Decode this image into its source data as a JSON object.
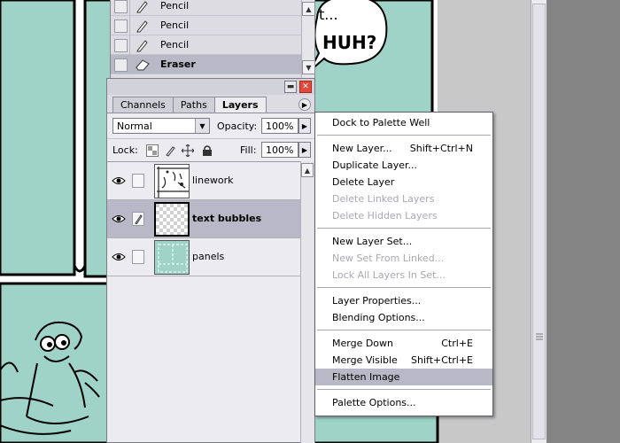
{
  "history": {
    "items": [
      {
        "label": "Pencil",
        "icon": "pencil-icon"
      },
      {
        "label": "Pencil",
        "icon": "pencil-icon"
      },
      {
        "label": "Pencil",
        "icon": "pencil-icon"
      },
      {
        "label": "Eraser",
        "icon": "eraser-icon",
        "selected": true
      }
    ]
  },
  "layers_palette": {
    "tabs": [
      {
        "label": "Channels"
      },
      {
        "label": "Paths"
      },
      {
        "label": "Layers",
        "active": true
      }
    ],
    "blend_mode": "Normal",
    "opacity_label": "Opacity:",
    "opacity_value": "100%",
    "lock_label": "Lock:",
    "fill_label": "Fill:",
    "fill_value": "100%",
    "layers": [
      {
        "name": "linework",
        "visible": true,
        "selected": false
      },
      {
        "name": "text bubbles",
        "visible": true,
        "selected": true
      },
      {
        "name": "panels",
        "visible": true,
        "selected": false
      }
    ]
  },
  "context_menu": {
    "items": [
      {
        "label": "Dock to Palette Well",
        "shortcut": "",
        "enabled": true
      },
      {
        "label": "New Layer...",
        "shortcut": "Shift+Ctrl+N",
        "enabled": true
      },
      {
        "label": "Duplicate Layer...",
        "shortcut": "",
        "enabled": true
      },
      {
        "label": "Delete Layer",
        "shortcut": "",
        "enabled": true
      },
      {
        "label": "Delete Linked Layers",
        "shortcut": "",
        "enabled": false
      },
      {
        "label": "Delete Hidden Layers",
        "shortcut": "",
        "enabled": false
      },
      {
        "label": "New Layer Set...",
        "shortcut": "",
        "enabled": true
      },
      {
        "label": "New Set From Linked...",
        "shortcut": "",
        "enabled": false
      },
      {
        "label": "Lock All Layers In Set...",
        "shortcut": "",
        "enabled": false
      },
      {
        "label": "Layer Properties...",
        "shortcut": "",
        "enabled": true
      },
      {
        "label": "Blending Options...",
        "shortcut": "",
        "enabled": true
      },
      {
        "label": "Merge Down",
        "shortcut": "Ctrl+E",
        "enabled": true
      },
      {
        "label": "Merge Visible",
        "shortcut": "Shift+Ctrl+E",
        "enabled": true
      },
      {
        "label": "Flatten Image",
        "shortcut": "",
        "enabled": true,
        "highlighted": true
      },
      {
        "label": "Palette Options...",
        "shortcut": "",
        "enabled": true
      }
    ]
  },
  "canvas": {
    "speech_bubble_text": "HUH?",
    "speech_bubble_partial": "t...",
    "panel_color": "#9fd3c7"
  },
  "colors": {
    "palette_bg": "#ececf0",
    "selection": "#b8b8c6",
    "workspace": "#848484"
  }
}
